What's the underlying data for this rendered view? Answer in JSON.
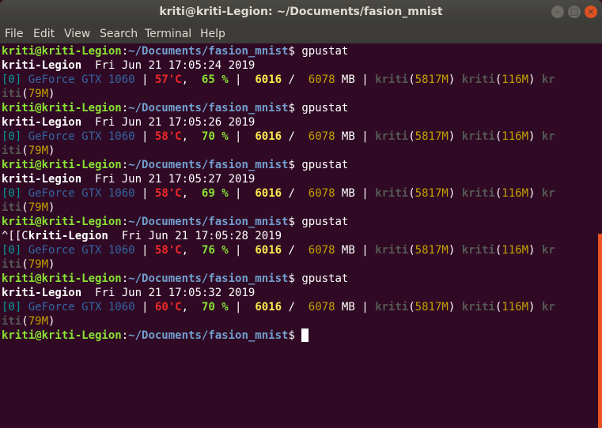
{
  "window": {
    "title": "kriti@kriti-Legion: ~/Documents/fasion_mnist",
    "buttons": {
      "minimize": "–",
      "maximize": "□",
      "close": "×"
    }
  },
  "menu": [
    "File",
    "Edit",
    "View",
    "Search",
    "Terminal",
    "Help"
  ],
  "prompt": {
    "user_host": "kriti@kriti-Legion",
    "colon": ":",
    "path": "~/Documents/fasion_mnist",
    "dollar": "$",
    "command": " gpustat"
  },
  "entries": [
    {
      "host_prefix": "",
      "host": "kriti-Legion",
      "time": "  Fri Jun 21 17:05:24 2019",
      "index": "[0]",
      "gpu": "GeForce GTX 1060",
      "temp": "57'C",
      "util": "65 %",
      "mem_used": "6016",
      "mem_total": "6078",
      "procs": [
        {
          "user": "kriti",
          "mem": "5817M"
        },
        {
          "user": "kriti",
          "mem": "116M"
        },
        {
          "user": "kriti",
          "mem": "79M"
        }
      ]
    },
    {
      "host_prefix": "",
      "host": "kriti-Legion",
      "time": "  Fri Jun 21 17:05:26 2019",
      "index": "[0]",
      "gpu": "GeForce GTX 1060",
      "temp": "58'C",
      "util": "70 %",
      "mem_used": "6016",
      "mem_total": "6078",
      "procs": [
        {
          "user": "kriti",
          "mem": "5817M"
        },
        {
          "user": "kriti",
          "mem": "116M"
        },
        {
          "user": "kriti",
          "mem": "79M"
        }
      ]
    },
    {
      "host_prefix": "",
      "host": "kriti-Legion",
      "time": "  Fri Jun 21 17:05:27 2019",
      "index": "[0]",
      "gpu": "GeForce GTX 1060",
      "temp": "58'C",
      "util": "69 %",
      "mem_used": "6016",
      "mem_total": "6078",
      "procs": [
        {
          "user": "kriti",
          "mem": "5817M"
        },
        {
          "user": "kriti",
          "mem": "116M"
        },
        {
          "user": "kriti",
          "mem": "79M"
        }
      ]
    },
    {
      "host_prefix": "^[[C",
      "host": "kriti-Legion",
      "time": "  Fri Jun 21 17:05:28 2019",
      "index": "[0]",
      "gpu": "GeForce GTX 1060",
      "temp": "58'C",
      "util": "76 %",
      "mem_used": "6016",
      "mem_total": "6078",
      "procs": [
        {
          "user": "kriti",
          "mem": "5817M"
        },
        {
          "user": "kriti",
          "mem": "116M"
        },
        {
          "user": "kriti",
          "mem": "79M"
        }
      ]
    },
    {
      "host_prefix": "",
      "host": "kriti-Legion",
      "time": "  Fri Jun 21 17:05:32 2019",
      "index": "[0]",
      "gpu": "GeForce GTX 1060",
      "temp": "60'C",
      "util": "70 %",
      "mem_used": "6016",
      "mem_total": "6078",
      "procs": [
        {
          "user": "kriti",
          "mem": "5817M"
        },
        {
          "user": "kriti",
          "mem": "116M"
        },
        {
          "user": "kriti",
          "mem": "79M"
        }
      ]
    }
  ],
  "colors": {
    "background": "#300a24",
    "prompt_user": "#8ae234",
    "prompt_path": "#729fcf",
    "temperature": "#ef2929",
    "utilization": "#8ae234",
    "memory_used": "#fce94f",
    "memory_total": "#c4a000",
    "scrollbar": "#e95420"
  }
}
